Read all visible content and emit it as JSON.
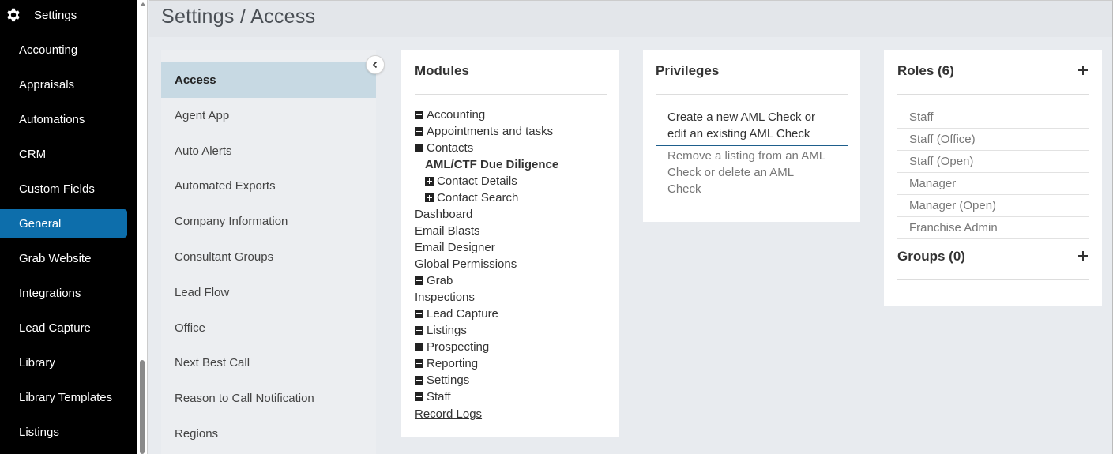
{
  "nav": {
    "title": "Settings",
    "items": [
      "Accounting",
      "Appraisals",
      "Automations",
      "CRM",
      "Custom Fields",
      "General",
      "Grab Website",
      "Integrations",
      "Lead Capture",
      "Library",
      "Library Templates",
      "Listings"
    ],
    "active": "General"
  },
  "page": {
    "title": "Settings / Access"
  },
  "submenu": {
    "items": [
      "Access",
      "Agent App",
      "Auto Alerts",
      "Automated Exports",
      "Company Information",
      "Consultant Groups",
      "Lead Flow",
      "Office",
      "Next Best Call",
      "Reason to Call Notification",
      "Regions"
    ],
    "active": "Access"
  },
  "modules": {
    "title": "Modules",
    "items": [
      {
        "label": "Accounting",
        "toggle": "plus"
      },
      {
        "label": "Appointments and tasks",
        "toggle": "plus"
      },
      {
        "label": "Contacts",
        "toggle": "minus"
      },
      {
        "label": "AML/CTF Due Diligence",
        "toggle": "none",
        "indent": 1,
        "bold": true
      },
      {
        "label": "Contact Details",
        "toggle": "plus",
        "indent": 1
      },
      {
        "label": "Contact Search",
        "toggle": "plus",
        "indent": 1
      },
      {
        "label": "Dashboard",
        "toggle": "none"
      },
      {
        "label": "Email Blasts",
        "toggle": "none"
      },
      {
        "label": "Email Designer",
        "toggle": "none"
      },
      {
        "label": "Global Permissions",
        "toggle": "none"
      },
      {
        "label": "Grab",
        "toggle": "plus"
      },
      {
        "label": "Inspections",
        "toggle": "none"
      },
      {
        "label": "Lead Capture",
        "toggle": "plus"
      },
      {
        "label": "Listings",
        "toggle": "plus"
      },
      {
        "label": "Prospecting",
        "toggle": "plus"
      },
      {
        "label": "Reporting",
        "toggle": "plus"
      },
      {
        "label": "Settings",
        "toggle": "plus"
      },
      {
        "label": "Staff",
        "toggle": "plus"
      },
      {
        "label": "Record Logs",
        "toggle": "none",
        "link": true
      }
    ]
  },
  "privileges": {
    "title": "Privileges",
    "items": [
      {
        "line1": "Create a new AML Check or",
        "line2": "edit an existing AML Check",
        "line3": "",
        "selected": true
      },
      {
        "line1": "Remove a listing from an AML",
        "line2": "Check or delete an AML",
        "line3": "Check",
        "selected": false
      }
    ]
  },
  "roles": {
    "title": "Roles (6)",
    "items": [
      "Staff",
      "Staff (Office)",
      "Staff (Open)",
      "Manager",
      "Manager (Open)",
      "Franchise Admin"
    ],
    "groups_title": "Groups (0)"
  },
  "colors": {
    "nav_bg": "#000000",
    "active_nav": "#0d6eab",
    "submenu_active": "#c7d9e3",
    "main_bg": "#e8ebef"
  },
  "icons": {
    "nav_title": "gear-icon",
    "collapse": "chevron-left-icon",
    "add_role": "plus-icon",
    "add_group": "plus-icon"
  }
}
